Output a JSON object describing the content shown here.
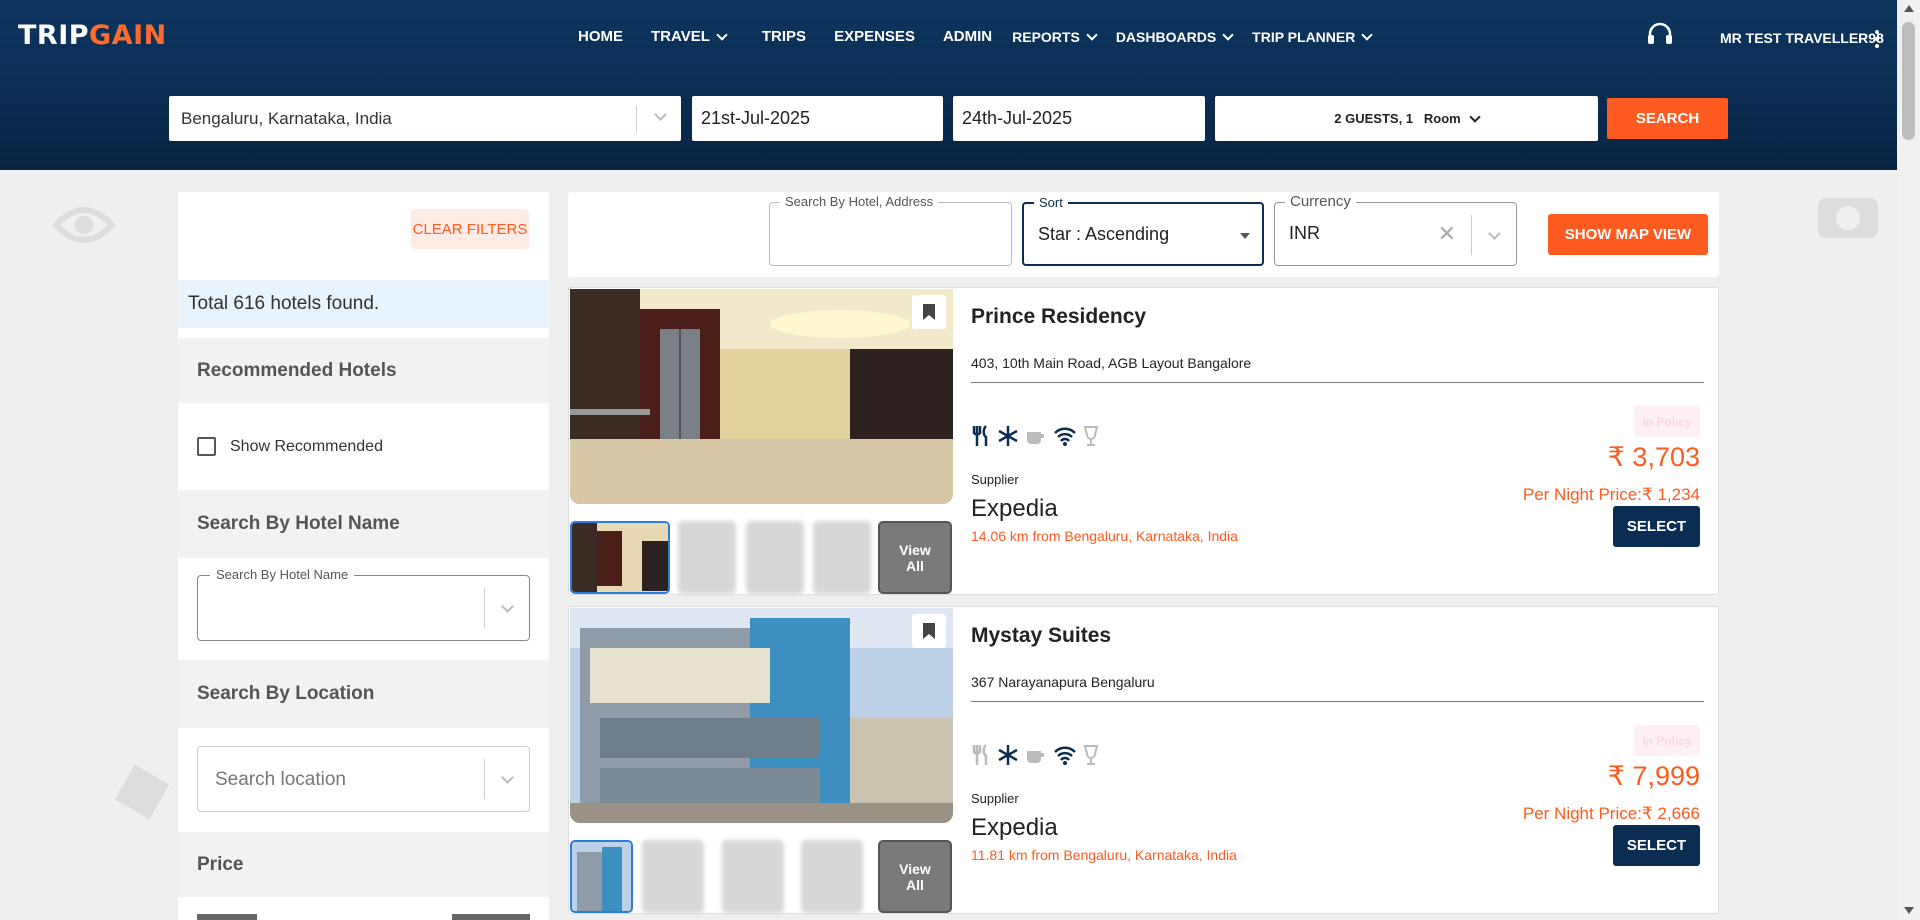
{
  "header": {
    "logo_part1": "TRIP",
    "logo_part2": "GAIN",
    "nav": [
      {
        "label": "HOME"
      },
      {
        "label": "TRAVEL"
      },
      {
        "label": "TRIPS"
      },
      {
        "label": "EXPENSES"
      },
      {
        "label": "ADMIN"
      },
      {
        "label": "REPORTS"
      },
      {
        "label": "DASHBOARDS"
      },
      {
        "label": "TRIP PLANNER"
      }
    ],
    "user_name": "MR TEST TRAVELLER98"
  },
  "search_bar": {
    "location": "Bengaluru, Karnataka, India",
    "check_in": "21st-Jul-2025",
    "check_out": "24th-Jul-2025",
    "guests": "2 GUESTS, 1",
    "rooms_label": "Room",
    "search_label": "SEARCH"
  },
  "sidebar": {
    "clear_filters": "CLEAR FILTERS",
    "total": "Total 616 hotels found.",
    "recommended_heading": "Recommended Hotels",
    "show_recommended": "Show Recommended",
    "hotel_name_heading": "Search By Hotel Name",
    "hotel_name_label": "Search By Hotel Name",
    "location_heading": "Search By Location",
    "location_placeholder": "Search location",
    "price_heading": "Price"
  },
  "filter_bar": {
    "search_label": "Search By Hotel, Address",
    "sort_label": "Sort",
    "sort_value": "Star : Ascending",
    "currency_label": "Currency",
    "currency_value": "INR",
    "map_button": "SHOW MAP VIEW"
  },
  "hotels": [
    {
      "name": "Prince Residency",
      "address": "403, 10th Main Road, AGB Layout Bangalore",
      "policy": "In Policy",
      "price": "₹ 3,703",
      "per_night": "Per Night Price:₹ 1,234",
      "supplier_label": "Supplier",
      "supplier": "Expedia",
      "distance": "14.06 km from Bengaluru, Karnataka, India",
      "view_all": "View All",
      "select": "SELECT"
    },
    {
      "name": "Mystay Suites",
      "address": "367 Narayanapura Bengaluru",
      "policy": "In Policy",
      "price": "₹ 7,999",
      "per_night": "Per Night Price:₹ 2,666",
      "supplier_label": "Supplier",
      "supplier": "Expedia",
      "distance": "11.81 km from Bengaluru, Karnataka, India",
      "view_all": "View All",
      "select": "SELECT"
    }
  ],
  "colors": {
    "header_navy": "#0b2d52",
    "accent_orange": "#ff5a1f",
    "select_navy": "#0b2d52"
  }
}
